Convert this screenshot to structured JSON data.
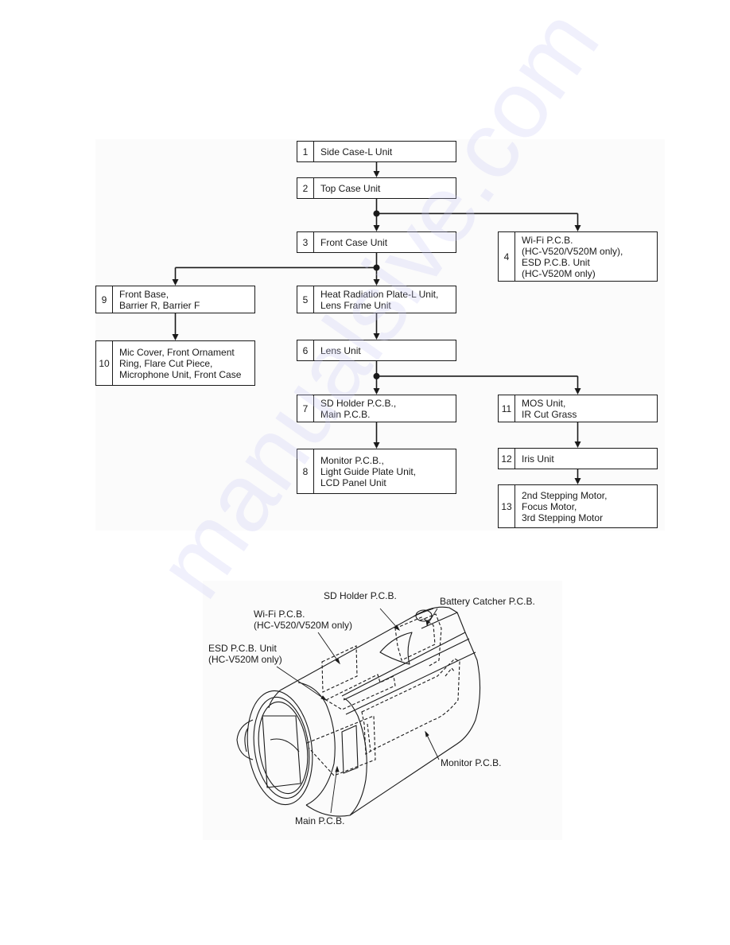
{
  "flowchart": {
    "steps": [
      {
        "num": "1",
        "label": "Side Case-L Unit"
      },
      {
        "num": "2",
        "label": "Top Case Unit"
      },
      {
        "num": "3",
        "label": "Front Case Unit"
      },
      {
        "num": "4",
        "label": "Wi-Fi P.C.B.\n(HC-V520/V520M only),\nESD P.C.B. Unit\n(HC-V520M only)"
      },
      {
        "num": "5",
        "label": "Heat Radiation Plate-L Unit,\nLens Frame Unit"
      },
      {
        "num": "6",
        "label": "Lens Unit"
      },
      {
        "num": "7",
        "label": "SD Holder P.C.B.,\nMain P.C.B."
      },
      {
        "num": "8",
        "label": "Monitor P.C.B.,\nLight Guide Plate Unit,\nLCD Panel Unit"
      },
      {
        "num": "9",
        "label": "Front Base,\nBarrier R, Barrier F"
      },
      {
        "num": "10",
        "label": "Mic Cover, Front Ornament\nRing, Flare Cut Piece,\nMicrophone Unit, Front Case"
      },
      {
        "num": "11",
        "label": "MOS Unit,\nIR Cut Grass"
      },
      {
        "num": "12",
        "label": "Iris Unit"
      },
      {
        "num": "13",
        "label": "2nd Stepping Motor,\nFocus Motor,\n3rd Stepping Motor"
      }
    ],
    "connections": [
      {
        "from": "1",
        "to": "2"
      },
      {
        "from": "2",
        "to": "3"
      },
      {
        "from": "2",
        "to": "4"
      },
      {
        "from": "3",
        "to": "5"
      },
      {
        "from": "3",
        "to": "9"
      },
      {
        "from": "5",
        "to": "6"
      },
      {
        "from": "6",
        "to": "7"
      },
      {
        "from": "6",
        "to": "11"
      },
      {
        "from": "7",
        "to": "8"
      },
      {
        "from": "9",
        "to": "10"
      },
      {
        "from": "11",
        "to": "12"
      },
      {
        "from": "12",
        "to": "13"
      }
    ]
  },
  "illustration": {
    "subject": "camcorder",
    "callouts": {
      "sd_holder": "SD Holder P.C.B.",
      "battery_catcher": "Battery Catcher P.C.B.",
      "wifi": "Wi-Fi P.C.B.\n(HC-V520/V520M only)",
      "esd": "ESD P.C.B. Unit\n(HC-V520M only)",
      "monitor": "Monitor P.C.B.",
      "main": "Main P.C.B."
    }
  },
  "colors": {
    "line": "#1a1a1a",
    "panel": "#fbfbfb",
    "watermark": "#c8c8f5"
  }
}
